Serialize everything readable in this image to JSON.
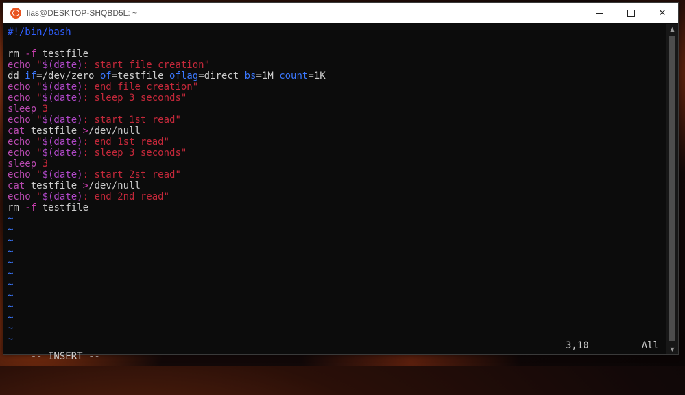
{
  "window": {
    "title": "lias@DESKTOP-SHQBD5L: ~",
    "app_icon": "ubuntu-icon",
    "controls": [
      "minimize",
      "maximize",
      "close"
    ],
    "close_glyph": "✕"
  },
  "editor": {
    "lines": [
      [
        {
          "t": "#!/bin/bash",
          "c": "comment"
        }
      ],
      [],
      [
        {
          "t": "rm",
          "c": "cmd"
        },
        {
          "t": " -f",
          "c": "opt"
        },
        {
          "t": " testfile",
          "c": "cmd"
        }
      ],
      [
        {
          "t": "echo",
          "c": "kw"
        },
        {
          "t": " \"",
          "c": "str"
        },
        {
          "t": "$(date)",
          "c": "sub"
        },
        {
          "t": ": start file creation\"",
          "c": "str"
        }
      ],
      [
        {
          "t": "dd ",
          "c": "cmd"
        },
        {
          "t": "if",
          "c": "attr"
        },
        {
          "t": "=/dev/zero ",
          "c": "cmd"
        },
        {
          "t": "of",
          "c": "attr"
        },
        {
          "t": "=testfile ",
          "c": "cmd"
        },
        {
          "t": "oflag",
          "c": "attr"
        },
        {
          "t": "=direct ",
          "c": "cmd"
        },
        {
          "t": "bs",
          "c": "attr"
        },
        {
          "t": "=1M ",
          "c": "cmd"
        },
        {
          "t": "count",
          "c": "attr"
        },
        {
          "t": "=1K",
          "c": "cmd"
        }
      ],
      [
        {
          "t": "echo",
          "c": "kw"
        },
        {
          "t": " \"",
          "c": "str"
        },
        {
          "t": "$(date)",
          "c": "sub"
        },
        {
          "t": ": end file creation\"",
          "c": "str"
        }
      ],
      [
        {
          "t": "echo",
          "c": "kw"
        },
        {
          "t": " \"",
          "c": "str"
        },
        {
          "t": "$(date)",
          "c": "sub"
        },
        {
          "t": ": sleep 3 seconds\"",
          "c": "str"
        }
      ],
      [
        {
          "t": "sleep",
          "c": "kw"
        },
        {
          "t": " 3",
          "c": "num"
        }
      ],
      [
        {
          "t": "echo",
          "c": "kw"
        },
        {
          "t": " \"",
          "c": "str"
        },
        {
          "t": "$(date)",
          "c": "sub"
        },
        {
          "t": ": start 1st read\"",
          "c": "str"
        }
      ],
      [
        {
          "t": "cat",
          "c": "kw"
        },
        {
          "t": " testfile ",
          "c": "cmd"
        },
        {
          "t": ">",
          "c": "opt"
        },
        {
          "t": "/dev/null",
          "c": "cmd"
        }
      ],
      [
        {
          "t": "echo",
          "c": "kw"
        },
        {
          "t": " \"",
          "c": "str"
        },
        {
          "t": "$(date)",
          "c": "sub"
        },
        {
          "t": ": end 1st read\"",
          "c": "str"
        }
      ],
      [
        {
          "t": "echo",
          "c": "kw"
        },
        {
          "t": " \"",
          "c": "str"
        },
        {
          "t": "$(date)",
          "c": "sub"
        },
        {
          "t": ": sleep 3 seconds\"",
          "c": "str"
        }
      ],
      [
        {
          "t": "sleep",
          "c": "kw"
        },
        {
          "t": " 3",
          "c": "num"
        }
      ],
      [
        {
          "t": "echo",
          "c": "kw"
        },
        {
          "t": " \"",
          "c": "str"
        },
        {
          "t": "$(date)",
          "c": "sub"
        },
        {
          "t": ": start 2st read\"",
          "c": "str"
        }
      ],
      [
        {
          "t": "cat",
          "c": "kw"
        },
        {
          "t": " testfile ",
          "c": "cmd"
        },
        {
          "t": ">",
          "c": "opt"
        },
        {
          "t": "/dev/null",
          "c": "cmd"
        }
      ],
      [
        {
          "t": "echo",
          "c": "kw"
        },
        {
          "t": " \"",
          "c": "str"
        },
        {
          "t": "$(date)",
          "c": "sub"
        },
        {
          "t": ": end 2nd read\"",
          "c": "str"
        }
      ],
      [
        {
          "t": "rm",
          "c": "cmd"
        },
        {
          "t": " -f",
          "c": "opt"
        },
        {
          "t": " testfile",
          "c": "cmd"
        }
      ]
    ],
    "tilde": "~",
    "tilde_count": 12
  },
  "status": {
    "mode": "-- INSERT --",
    "cursor": "3,10",
    "scroll": "All"
  },
  "colors": {
    "comment": "#2f5fff",
    "keyword": "#b84ab0",
    "string": "#c4283a",
    "substitution": "#b048c8",
    "attribute": "#3b78ff",
    "tilde": "#3b78ff",
    "background": "#0c0c0c"
  }
}
